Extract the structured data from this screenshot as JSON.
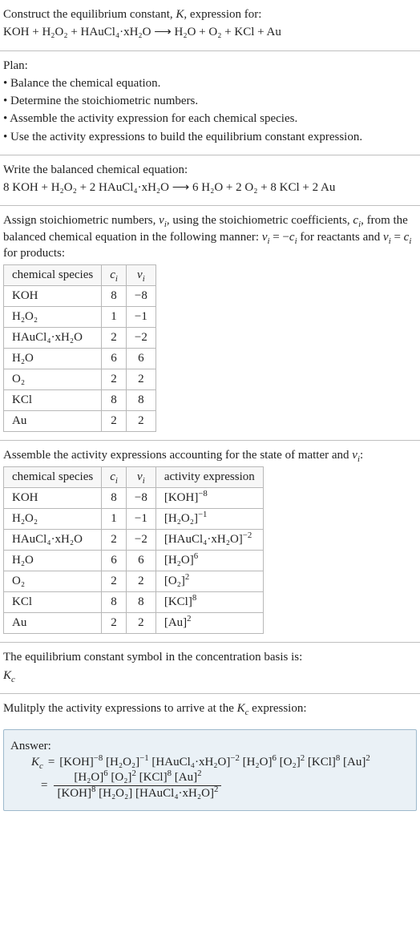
{
  "intro": {
    "title_line1": "Construct the equilibrium constant, K, expression for:",
    "reaction": "KOH + H₂O₂ + HAuCl₄·xH₂O ⟶ H₂O + O₂ + KCl + Au"
  },
  "plan": {
    "heading": "Plan:",
    "bullets": [
      "• Balance the chemical equation.",
      "• Determine the stoichiometric numbers.",
      "• Assemble the activity expression for each chemical species.",
      "• Use the activity expressions to build the equilibrium constant expression."
    ]
  },
  "balanced": {
    "heading": "Write the balanced chemical equation:",
    "equation": "8 KOH + H₂O₂ + 2 HAuCl₄·xH₂O ⟶ 6 H₂O + 2 O₂ + 8 KCl + 2 Au"
  },
  "stoich": {
    "intro": "Assign stoichiometric numbers, νᵢ, using the stoichiometric coefficients, cᵢ, from the balanced chemical equation in the following manner: νᵢ = −cᵢ for reactants and νᵢ = cᵢ for products:",
    "headers": [
      "chemical species",
      "cᵢ",
      "νᵢ"
    ],
    "rows": [
      {
        "species": "KOH",
        "c": "8",
        "nu": "−8"
      },
      {
        "species": "H₂O₂",
        "c": "1",
        "nu": "−1"
      },
      {
        "species": "HAuCl₄·xH₂O",
        "c": "2",
        "nu": "−2"
      },
      {
        "species": "H₂O",
        "c": "6",
        "nu": "6"
      },
      {
        "species": "O₂",
        "c": "2",
        "nu": "2"
      },
      {
        "species": "KCl",
        "c": "8",
        "nu": "8"
      },
      {
        "species": "Au",
        "c": "2",
        "nu": "2"
      }
    ]
  },
  "activity": {
    "intro": "Assemble the activity expressions accounting for the state of matter and νᵢ:",
    "headers": [
      "chemical species",
      "cᵢ",
      "νᵢ",
      "activity expression"
    ],
    "rows": [
      {
        "species": "KOH",
        "c": "8",
        "nu": "−8",
        "expr_base": "[KOH]",
        "expr_pow": "−8"
      },
      {
        "species": "H₂O₂",
        "c": "1",
        "nu": "−1",
        "expr_base": "[H₂O₂]",
        "expr_pow": "−1"
      },
      {
        "species": "HAuCl₄·xH₂O",
        "c": "2",
        "nu": "−2",
        "expr_base": "[HAuCl₄·xH₂O]",
        "expr_pow": "−2"
      },
      {
        "species": "H₂O",
        "c": "6",
        "nu": "6",
        "expr_base": "[H₂O]",
        "expr_pow": "6"
      },
      {
        "species": "O₂",
        "c": "2",
        "nu": "2",
        "expr_base": "[O₂]",
        "expr_pow": "2"
      },
      {
        "species": "KCl",
        "c": "8",
        "nu": "8",
        "expr_base": "[KCl]",
        "expr_pow": "8"
      },
      {
        "species": "Au",
        "c": "2",
        "nu": "2",
        "expr_base": "[Au]",
        "expr_pow": "2"
      }
    ]
  },
  "kc_symbol": {
    "intro": "The equilibrium constant symbol in the concentration basis is:",
    "symbol": "K_c"
  },
  "final": {
    "intro": "Mulitply the activity expressions to arrive at the K_c expression:",
    "answer_label": "Answer:",
    "kc_label": "K_c",
    "terms1": [
      {
        "base": "[KOH]",
        "pow": "−8"
      },
      {
        "base": "[H₂O₂]",
        "pow": "−1"
      },
      {
        "base": "[HAuCl₄·xH₂O]",
        "pow": "−2"
      },
      {
        "base": "[H₂O]",
        "pow": "6"
      },
      {
        "base": "[O₂]",
        "pow": "2"
      },
      {
        "base": "[KCl]",
        "pow": "8"
      },
      {
        "base": "[Au]",
        "pow": "2"
      }
    ],
    "frac_num": [
      {
        "base": "[H₂O]",
        "pow": "6"
      },
      {
        "base": "[O₂]",
        "pow": "2"
      },
      {
        "base": "[KCl]",
        "pow": "8"
      },
      {
        "base": "[Au]",
        "pow": "2"
      }
    ],
    "frac_den": [
      {
        "base": "[KOH]",
        "pow": "8"
      },
      {
        "base": "[H₂O₂]",
        "pow": ""
      },
      {
        "base": "[HAuCl₄·xH₂O]",
        "pow": "2"
      }
    ]
  },
  "chart_data": {
    "type": "table",
    "title": "Stoichiometric numbers and activity expressions",
    "species": [
      "KOH",
      "H₂O₂",
      "HAuCl₄·xH₂O",
      "H₂O",
      "O₂",
      "KCl",
      "Au"
    ],
    "c_i": [
      8,
      1,
      2,
      6,
      2,
      8,
      2
    ],
    "nu_i": [
      -8,
      -1,
      -2,
      6,
      2,
      8,
      2
    ],
    "activity_expressions": [
      "[KOH]^-8",
      "[H2O2]^-1",
      "[HAuCl4·xH2O]^-2",
      "[H2O]^6",
      "[O2]^2",
      "[KCl]^8",
      "[Au]^2"
    ]
  }
}
